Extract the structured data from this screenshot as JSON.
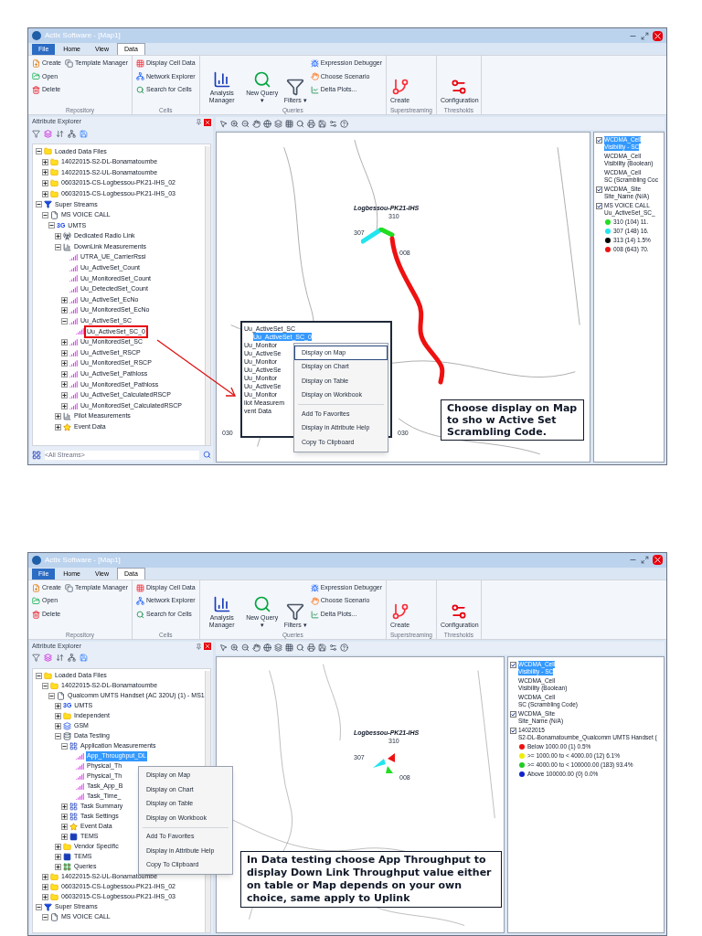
{
  "screens": [
    {
      "window_title": "Actix Software - [Map1]",
      "ribbon_tabs": [
        {
          "label": "File",
          "kind": "file",
          "selected": false
        },
        {
          "label": "Home",
          "kind": "tab",
          "selected": false
        },
        {
          "label": "View",
          "kind": "tab",
          "selected": false
        },
        {
          "label": "Data",
          "kind": "tab",
          "selected": true
        }
      ],
      "ribbon_groups": [
        {
          "label": "Repository",
          "items": [
            {
              "label": "Create",
              "kind": "small"
            },
            {
              "label": "Open",
              "kind": "small"
            },
            {
              "label": "Delete",
              "kind": "small"
            },
            {
              "label": "Template Manager",
              "kind": "small"
            }
          ]
        },
        {
          "label": "Cells",
          "items": [
            {
              "label": "Display Cell Data",
              "kind": "small"
            },
            {
              "label": "Network Explorer",
              "kind": "small"
            },
            {
              "label": "Search for Cells",
              "kind": "small"
            }
          ]
        },
        {
          "label": "Queries",
          "items": [
            {
              "label": "Analysis Manager",
              "kind": "large"
            },
            {
              "label": "New Query ▾",
              "kind": "large"
            },
            {
              "label": "Filters ▾",
              "kind": "large"
            },
            {
              "label": "Expression Debugger",
              "kind": "small"
            },
            {
              "label": "Choose Scenario",
              "kind": "small"
            },
            {
              "label": "Delta Plots...",
              "kind": "small"
            }
          ]
        },
        {
          "label": "Superstreaming",
          "items": [
            {
              "label": "Create",
              "kind": "large"
            }
          ]
        },
        {
          "label": "Thresholds",
          "items": [
            {
              "label": "Configuration",
              "kind": "large"
            }
          ]
        }
      ],
      "explorer_title": "Attribute Explorer",
      "tree": [
        {
          "label": "Loaded Data Files",
          "kind": "folder",
          "expanded": true,
          "selected": false,
          "boxed": false,
          "children": [
            {
              "label": "14022015-S2-DL-Bonamatoumbe",
              "kind": "folder",
              "expanded": false,
              "selected": false,
              "boxed": false
            },
            {
              "label": "14022015-S2-UL-Bonamatoumbe",
              "kind": "folder",
              "expanded": false,
              "selected": false,
              "boxed": false
            },
            {
              "label": "06032015-CS-Logbessou-PK21-IHS_02",
              "kind": "folder",
              "expanded": false,
              "selected": false,
              "boxed": false
            },
            {
              "label": "06032015-CS-Logbessou-PK21-IHS_03",
              "kind": "folder",
              "expanded": false,
              "selected": false,
              "boxed": false
            }
          ]
        },
        {
          "label": "Super Streams",
          "kind": "stream",
          "expanded": true,
          "selected": false,
          "boxed": false,
          "children": [
            {
              "label": "MS VOICE CALL",
              "kind": "doc",
              "expanded": true,
              "selected": false,
              "boxed": false,
              "children": [
                {
                  "label": "UMTS",
                  "badge": "3G",
                  "kind": "badge",
                  "expanded": true,
                  "selected": false,
                  "boxed": false,
                  "children": [
                    {
                      "label": "Dedicated Radio Link",
                      "kind": "antenna",
                      "expanded": false,
                      "selected": false,
                      "boxed": false
                    },
                    {
                      "label": "DownLink Measurements",
                      "kind": "measure",
                      "expanded": true,
                      "selected": false,
                      "boxed": false,
                      "children": [
                        {
                          "label": "UTRA_UE_CarrierRssi",
                          "kind": "attr",
                          "selected": false,
                          "boxed": false
                        },
                        {
                          "label": "Uu_ActiveSet_Count",
                          "kind": "attr",
                          "selected": false,
                          "boxed": false
                        },
                        {
                          "label": "Uu_MonitoredSet_Count",
                          "kind": "attr",
                          "selected": false,
                          "boxed": false
                        },
                        {
                          "label": "Uu_DetectedSet_Count",
                          "kind": "attr",
                          "selected": false,
                          "boxed": false
                        },
                        {
                          "label": "Uu_ActiveSet_EcNo",
                          "kind": "attr",
                          "expanded": false,
                          "selected": false,
                          "boxed": false
                        },
                        {
                          "label": "Uu_MonitoredSet_EcNo",
                          "kind": "attr",
                          "expanded": false,
                          "selected": false,
                          "boxed": false
                        },
                        {
                          "label": "Uu_ActiveSet_SC",
                          "kind": "attr",
                          "expanded": true,
                          "selected": false,
                          "boxed": false,
                          "children": [
                            {
                              "label": "Uu_ActiveSet_SC_0",
                              "kind": "attr",
                              "selected": false,
                              "boxed": true
                            }
                          ]
                        },
                        {
                          "label": "Uu_MonitoredSet_SC",
                          "kind": "attr",
                          "expanded": false,
                          "selected": false,
                          "boxed": false
                        },
                        {
                          "label": "Uu_ActiveSet_RSCP",
                          "kind": "attr",
                          "expanded": false,
                          "selected": false,
                          "boxed": false
                        },
                        {
                          "label": "Uu_MonitoredSet_RSCP",
                          "kind": "attr",
                          "expanded": false,
                          "selected": false,
                          "boxed": false
                        },
                        {
                          "label": "Uu_ActiveSet_Pathloss",
                          "kind": "attr",
                          "expanded": false,
                          "selected": false,
                          "boxed": false
                        },
                        {
                          "label": "Uu_MonitoredSet_Pathloss",
                          "kind": "attr",
                          "expanded": false,
                          "selected": false,
                          "boxed": false
                        },
                        {
                          "label": "Uu_ActiveSet_CalculatedRSCP",
                          "kind": "attr",
                          "expanded": false,
                          "selected": false,
                          "boxed": false
                        },
                        {
                          "label": "Uu_MonitoredSet_CalculatedRSCP",
                          "kind": "attr",
                          "expanded": false,
                          "selected": false,
                          "boxed": false
                        }
                      ]
                    },
                    {
                      "label": "Pilot Measurements",
                      "kind": "measure",
                      "expanded": false,
                      "selected": false,
                      "boxed": false
                    },
                    {
                      "label": "Event Data",
                      "kind": "event",
                      "expanded": false,
                      "selected": false,
                      "boxed": false
                    }
                  ]
                }
              ]
            }
          ]
        }
      ],
      "stream_filter": "<All Streams>",
      "map": {
        "site_label": "Logbessou-PK21-IHS",
        "sector_labels": [
          "310",
          "307",
          "008"
        ],
        "edge_labels": [
          "030",
          "030"
        ]
      },
      "inset": {
        "rows": [
          {
            "label": "Uu_ActiveSet_SC",
            "selected": false
          },
          {
            "label": "Uu_ActiveSet_SC_0",
            "selected": true
          },
          {
            "label": "Uu_Monitor",
            "selected": false
          },
          {
            "label": "Uu_ActiveSe",
            "selected": false
          },
          {
            "label": "Uu_Monitor",
            "selected": false
          },
          {
            "label": "Uu_ActiveSe",
            "selected": false
          },
          {
            "label": "Uu_Monitor",
            "selected": false
          },
          {
            "label": "Uu_ActiveSe",
            "selected": false
          },
          {
            "label": "Uu_Monitor",
            "selected": false
          },
          {
            "label": "ilot Measurem",
            "selected": false
          },
          {
            "label": "vent Data",
            "selected": false
          }
        ]
      },
      "context_menu": [
        {
          "label": "Display on Map",
          "selected": true
        },
        {
          "label": "Display on Chart",
          "selected": false
        },
        {
          "label": "Display on Table",
          "selected": false
        },
        {
          "label": "Display on Workbook",
          "selected": false
        },
        {
          "label": "Add To Favorites",
          "selected": false
        },
        {
          "label": "Display in Attribute Help",
          "selected": false
        },
        {
          "label": "Copy To Clipboard",
          "selected": false
        }
      ],
      "legend": [
        {
          "kind": "layer",
          "title": "WCDMA_Cell",
          "subtitle": "Visibility - SC",
          "checked": true,
          "selected": true
        },
        {
          "kind": "layer",
          "title": "WCDMA_Cell",
          "subtitle": "Visibility (Boolean)",
          "checked": false,
          "selected": false
        },
        {
          "kind": "layer",
          "title": "WCDMA_Cell",
          "subtitle": "SC (Scrambling Coc",
          "checked": false,
          "selected": false
        },
        {
          "kind": "layer",
          "title": "WCDMA_Site",
          "subtitle": "Site_Name (N/A)",
          "checked": true,
          "selected": false
        },
        {
          "kind": "layer",
          "title": "MS VOICE CALL",
          "subtitle": "Uu_ActiveSet_SC_",
          "checked": true,
          "selected": false
        },
        {
          "kind": "entry",
          "label": "310 (104) 11.",
          "color": "#22dd22"
        },
        {
          "kind": "entry",
          "label": "307 (148) 16.",
          "color": "#22e5ee"
        },
        {
          "kind": "entry",
          "label": "313 (14) 1.5%",
          "color": "#000000"
        },
        {
          "kind": "entry",
          "label": "008 (643) 70.",
          "color": "#ee1111"
        }
      ],
      "callout": "Choose display on Map to sho w Active Set Scrambling Code."
    },
    {
      "window_title": "Actix Software - [Map1]",
      "ribbon_tabs": [
        {
          "label": "File",
          "kind": "file",
          "selected": false
        },
        {
          "label": "Home",
          "kind": "tab",
          "selected": false
        },
        {
          "label": "View",
          "kind": "tab",
          "selected": false
        },
        {
          "label": "Data",
          "kind": "tab",
          "selected": true
        }
      ],
      "ribbon_groups": [
        {
          "label": "Repository",
          "items": [
            {
              "label": "Create",
              "kind": "small"
            },
            {
              "label": "Open",
              "kind": "small"
            },
            {
              "label": "Delete",
              "kind": "small"
            },
            {
              "label": "Template Manager",
              "kind": "small"
            }
          ]
        },
        {
          "label": "Cells",
          "items": [
            {
              "label": "Display Cell Data",
              "kind": "small"
            },
            {
              "label": "Network Explorer",
              "kind": "small"
            },
            {
              "label": "Search for Cells",
              "kind": "small"
            }
          ]
        },
        {
          "label": "Queries",
          "items": [
            {
              "label": "Analysis Manager",
              "kind": "large"
            },
            {
              "label": "New Query ▾",
              "kind": "large"
            },
            {
              "label": "Filters ▾",
              "kind": "large"
            },
            {
              "label": "Expression Debugger",
              "kind": "small"
            },
            {
              "label": "Choose Scenario",
              "kind": "small"
            },
            {
              "label": "Delta Plots...",
              "kind": "small"
            }
          ]
        },
        {
          "label": "Superstreaming",
          "items": [
            {
              "label": "Create",
              "kind": "large"
            }
          ]
        },
        {
          "label": "Thresholds",
          "items": [
            {
              "label": "Configuration",
              "kind": "large"
            }
          ]
        }
      ],
      "explorer_title": "Attribute Explorer",
      "tree": [
        {
          "label": "Loaded Data Files",
          "kind": "folder",
          "expanded": true,
          "selected": false,
          "boxed": false,
          "children": [
            {
              "label": "14022015-S2-DL-Bonamatoumbe",
              "kind": "folder",
              "expanded": true,
              "selected": false,
              "boxed": false,
              "children": [
                {
                  "label": "Qualcomm UMTS Handset (AC 320U) (1) - MS1",
                  "kind": "doc",
                  "expanded": true,
                  "selected": false,
                  "boxed": false,
                  "children": [
                    {
                      "label": "UMTS",
                      "badge": "3G",
                      "kind": "badge",
                      "expanded": false,
                      "selected": false,
                      "boxed": false
                    },
                    {
                      "label": "Independent",
                      "kind": "folder",
                      "expanded": false,
                      "selected": false,
                      "boxed": false
                    },
                    {
                      "label": "GSM",
                      "kind": "gsm",
                      "expanded": false,
                      "selected": false,
                      "boxed": false
                    },
                    {
                      "label": "Data Testing",
                      "kind": "data",
                      "expanded": true,
                      "selected": false,
                      "boxed": false,
                      "children": [
                        {
                          "label": "Application Measurements",
                          "kind": "app",
                          "expanded": true,
                          "selected": false,
                          "boxed": false,
                          "children": [
                            {
                              "label": "App_Throughput_DL",
                              "kind": "attr",
                              "selected": true,
                              "boxed": false
                            },
                            {
                              "label": "Physical_Th",
                              "kind": "attr",
                              "selected": false,
                              "boxed": false
                            },
                            {
                              "label": "Physical_Th",
                              "kind": "attr",
                              "selected": false,
                              "boxed": false
                            },
                            {
                              "label": "Task_App_B",
                              "kind": "attr",
                              "selected": false,
                              "boxed": false
                            },
                            {
                              "label": "Task_Time_",
                              "kind": "attr",
                              "selected": false,
                              "boxed": false
                            }
                          ]
                        },
                        {
                          "label": "Task Summary",
                          "kind": "app",
                          "expanded": false,
                          "selected": false,
                          "boxed": false
                        },
                        {
                          "label": "Task Settings",
                          "kind": "app",
                          "expanded": false,
                          "selected": false,
                          "boxed": false
                        },
                        {
                          "label": "Event Data",
                          "kind": "event",
                          "expanded": false,
                          "selected": false,
                          "boxed": false
                        },
                        {
                          "label": "TEMS",
                          "kind": "tems",
                          "expanded": false,
                          "selected": false,
                          "boxed": false
                        }
                      ]
                    },
                    {
                      "label": "Vendor Specific",
                      "kind": "folder",
                      "expanded": false,
                      "selected": false,
                      "boxed": false
                    },
                    {
                      "label": "TEMS",
                      "kind": "tems",
                      "expanded": false,
                      "selected": false,
                      "boxed": false
                    },
                    {
                      "label": "Queries",
                      "kind": "queries",
                      "expanded": false,
                      "selected": false,
                      "boxed": false
                    }
                  ]
                }
              ]
            },
            {
              "label": "14022015-S2-UL-Bonamatoumbe",
              "kind": "folder",
              "expanded": false,
              "selected": false,
              "boxed": false
            },
            {
              "label": "06032015-CS-Logbessou-PK21-IHS_02",
              "kind": "folder",
              "expanded": false,
              "selected": false,
              "boxed": false
            },
            {
              "label": "06032015-CS-Logbessou-PK21-IHS_03",
              "kind": "folder",
              "expanded": false,
              "selected": false,
              "boxed": false
            }
          ]
        },
        {
          "label": "Super Streams",
          "kind": "stream",
          "expanded": true,
          "selected": false,
          "boxed": false,
          "children": [
            {
              "label": "MS VOICE CALL",
              "kind": "doc",
              "expanded": true,
              "selected": false,
              "boxed": false
            }
          ]
        }
      ],
      "map": {
        "site_label": "Logbessou-PK21-IHS",
        "sector_labels": [
          "310",
          "307",
          "008"
        ]
      },
      "context_menu": [
        {
          "label": "Display on Map",
          "selected": false
        },
        {
          "label": "Display on Chart",
          "selected": false
        },
        {
          "label": "Display on Table",
          "selected": false
        },
        {
          "label": "Display on Workbook",
          "selected": false
        },
        {
          "label": "Add To Favorites",
          "selected": false
        },
        {
          "label": "Display in Attribute Help",
          "selected": false
        },
        {
          "label": "Copy To Clipboard",
          "selected": false
        }
      ],
      "legend": [
        {
          "kind": "layer",
          "title": "WCDMA_Cell",
          "subtitle": "Visibility - SC",
          "checked": true,
          "selected": true
        },
        {
          "kind": "layer",
          "title": "WCDMA_Cell",
          "subtitle": "Visibility (Boolean)",
          "checked": false,
          "selected": false
        },
        {
          "kind": "layer",
          "title": "WCDMA_Cell",
          "subtitle": "SC (Scrambling Code)",
          "checked": false,
          "selected": false
        },
        {
          "kind": "layer",
          "title": "WCDMA_Site",
          "subtitle": "Site_Name (N/A)",
          "checked": true,
          "selected": false
        },
        {
          "kind": "layer",
          "title": "14022015",
          "subtitle": "S2-DL-Bonamatoumbe_Qualcomm UMTS Handset (",
          "checked": true,
          "selected": false
        },
        {
          "kind": "entry",
          "label": "Below 1000.00 (1) 0.5%",
          "color": "#ee1111"
        },
        {
          "kind": "entry",
          "label": ">= 1000.00 to < 4000.00 (12) 6.1%",
          "color": "#eeee00"
        },
        {
          "kind": "entry",
          "label": ">= 4000.00 to < 100000.00 (183) 93.4%",
          "color": "#22cc22"
        },
        {
          "kind": "entry",
          "label": "Above 100000.00 (0) 0.0%",
          "color": "#1122cc"
        }
      ],
      "callout": "In Data testing choose App Throughput to display Down Link Throughput value either on table or Map depends on your own choice, same apply to Uplink"
    }
  ]
}
